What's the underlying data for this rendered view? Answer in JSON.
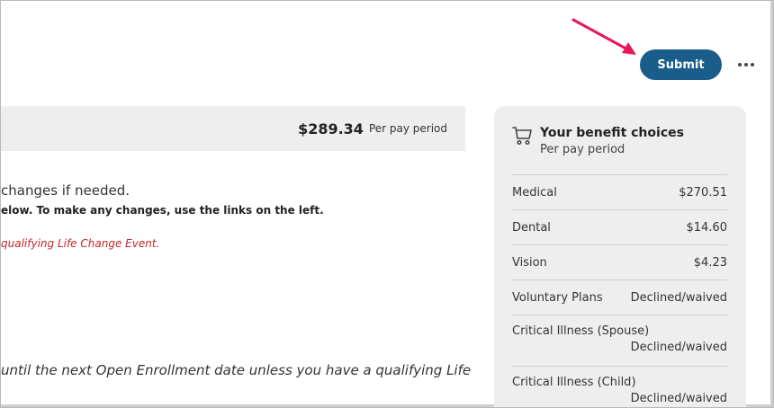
{
  "header": {
    "submit_label": "Submit",
    "more_icon": "more-horizontal-icon"
  },
  "summary": {
    "total_amount": "$289.34",
    "total_period": "Per pay period"
  },
  "content": {
    "line1": "changes if needed.",
    "line2": "elow. To make any changes, use the links on the left.",
    "line3": "qualifying Life Change Event.",
    "line4": "until the next Open Enrollment date unless you have a qualifying Life"
  },
  "benefits": {
    "icon": "shopping-cart-icon",
    "title": "Your benefit choices",
    "subtitle": "Per pay period",
    "items": [
      {
        "label": "Medical",
        "value": "$270.51"
      },
      {
        "label": "Dental",
        "value": "$14.60"
      },
      {
        "label": "Vision",
        "value": "$4.23"
      },
      {
        "label": "Voluntary Plans",
        "value": "Declined/waived"
      },
      {
        "label": "Critical Illness (Spouse)",
        "value": "Declined/waived"
      },
      {
        "label": "Critical Illness (Child)",
        "value": "Declined/waived"
      }
    ]
  },
  "colors": {
    "accent": "#1a5d8a",
    "warning_text": "#c0282d",
    "annotation_arrow": "#e8185a"
  }
}
